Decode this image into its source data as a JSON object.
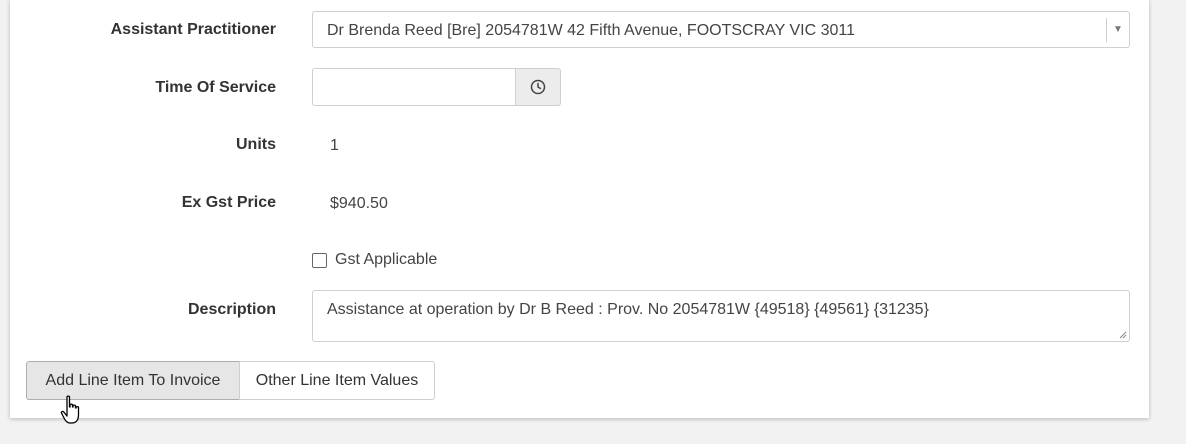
{
  "form": {
    "assistant_practitioner": {
      "label": "Assistant Practitioner",
      "value": "Dr Brenda Reed [Bre] 2054781W 42 Fifth Avenue, FOOTSCRAY VIC 3011"
    },
    "time_of_service": {
      "label": "Time Of Service",
      "value": "",
      "icon": "clock-icon"
    },
    "units": {
      "label": "Units",
      "value": "1"
    },
    "ex_gst_price": {
      "label": "Ex Gst Price",
      "value": "$940.50"
    },
    "gst_applicable": {
      "label": "Gst Applicable",
      "checked": false
    },
    "description": {
      "label": "Description",
      "value": "Assistance at operation by Dr B Reed : Prov. No 2054781W {49518} {49561} {31235}"
    }
  },
  "actions": {
    "add_line_item": "Add Line Item To Invoice",
    "other_line_item_values": "Other Line Item Values"
  }
}
